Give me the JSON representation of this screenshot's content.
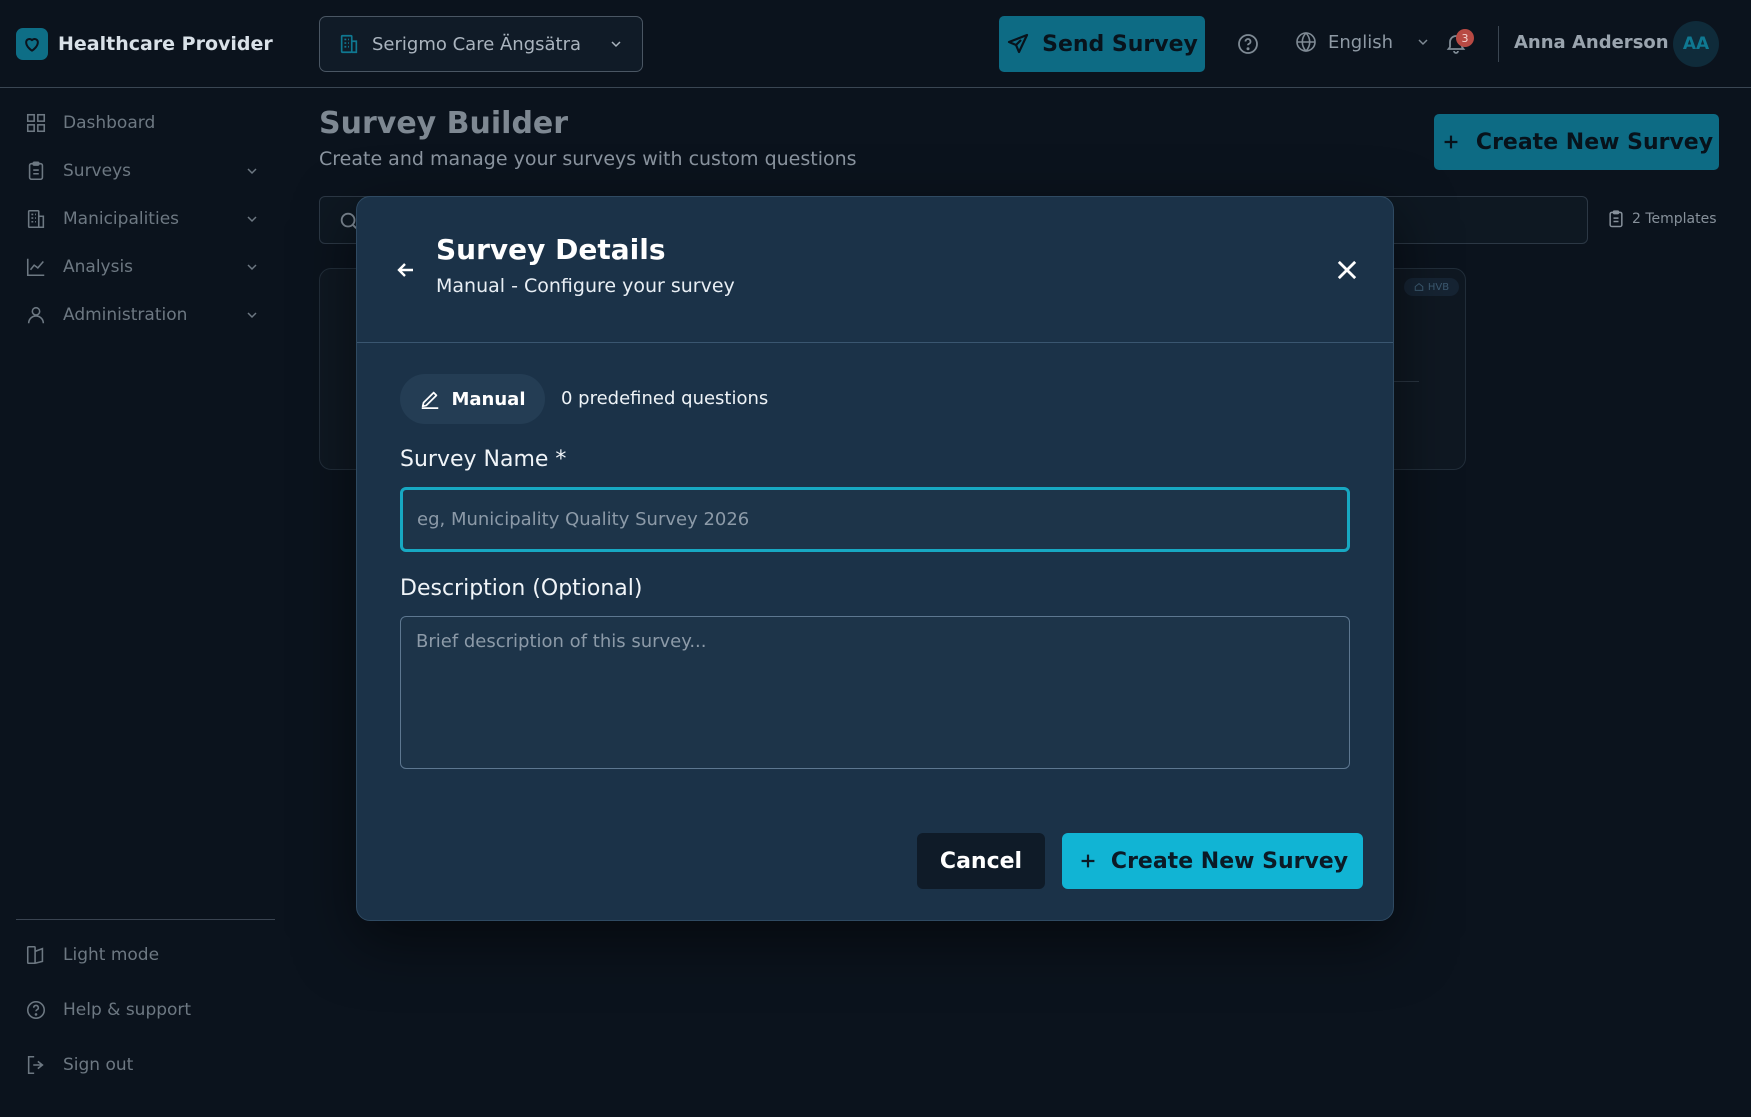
{
  "app": {
    "brand": "Healthcare Provider"
  },
  "header": {
    "organization": "Serigmo Care Ängsätra",
    "send_survey_label": "Send Survey",
    "language": "English",
    "notification_count": "3",
    "user_name": "Anna Anderson",
    "user_initials": "AA"
  },
  "sidebar": {
    "items": [
      {
        "label": "Dashboard",
        "icon": "grid-icon"
      },
      {
        "label": "Surveys",
        "icon": "clipboard-icon"
      },
      {
        "label": "Manicipalities",
        "icon": "building-icon"
      },
      {
        "label": "Analysis",
        "icon": "chart-line-icon"
      },
      {
        "label": "Administration",
        "icon": "user-icon"
      }
    ],
    "footer": [
      {
        "label": "Light mode",
        "icon": "theme-icon"
      },
      {
        "label": "Help & support",
        "icon": "help-icon"
      },
      {
        "label": "Sign out",
        "icon": "sign-out-icon"
      }
    ]
  },
  "page": {
    "title": "Survey Builder",
    "subtitle": "Create and manage your surveys with custom questions",
    "create_button": "Create New Survey",
    "templates_count": "2 Templates",
    "card_badge": "HVB"
  },
  "modal": {
    "title": "Survey Details",
    "subtitle": "Manual - Configure your survey",
    "mode_label": "Manual",
    "predefined_text": "0 predefined questions",
    "name_label": "Survey Name *",
    "name_placeholder": "eg, Municipality Quality Survey 2026",
    "name_value": "",
    "description_label": "Description (Optional)",
    "description_placeholder": "Brief description of this survey...",
    "description_value": "",
    "cancel_label": "Cancel",
    "create_label": "Create New Survey"
  },
  "colors": {
    "background": "#0b131d",
    "accent": "#11b4d4",
    "accent_dark": "#0d6b84",
    "modal_bg": "#1b3248",
    "badge_red": "#b84a44"
  }
}
